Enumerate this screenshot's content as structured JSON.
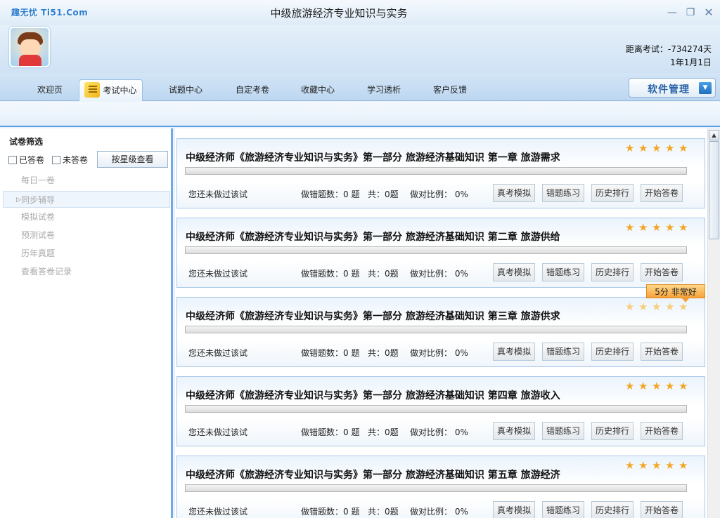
{
  "app": {
    "logo": "趣无忧 Ti51.Com",
    "title": "中级旅游经济专业知识与实务"
  },
  "window_controls": {
    "minimize": "—",
    "maximize": "❐",
    "close": "✕"
  },
  "header": {
    "countdown": "距离考试：-734274天",
    "exam_date": "1年1月1日"
  },
  "nav": {
    "tabs": [
      "欢迎页",
      "考试中心",
      "试题中心",
      "自定考卷",
      "收藏中心",
      "学习透析",
      "客户反馈"
    ],
    "active_index": 1,
    "software_mgmt": "软件管理",
    "dropdown_glyph": "▼"
  },
  "sidebar": {
    "filter_title": "试卷筛选",
    "answered": "已答卷",
    "unanswered": "未答卷",
    "star_view": "按星级查看",
    "items": [
      "每日一卷",
      "同步辅导",
      "模拟试卷",
      "预测试卷",
      "历年真题",
      "查看答卷记录"
    ],
    "selected_index": 1
  },
  "cards": [
    {
      "title": "中级经济师《旅游经济专业知识与实务》第一部分  旅游经济基础知识  第一章  旅游需求",
      "rating": 5,
      "progress": 0,
      "status": "您还未做过该试",
      "wrong": "做错题数：0 题",
      "total": "共：0题",
      "ratio": "做对比例： 0%"
    },
    {
      "title": "中级经济师《旅游经济专业知识与实务》第一部分  旅游经济基础知识  第二章  旅游供给",
      "rating": 5,
      "progress": 0,
      "status": "您还未做过该试",
      "wrong": "做错题数：0 题",
      "total": "共：0题",
      "ratio": "做对比例： 0%"
    },
    {
      "title": "中级经济师《旅游经济专业知识与实务》第一部分  旅游经济基础知识  第三章  旅游供求",
      "rating": 5,
      "progress": 0,
      "status": "您还未做过该试",
      "wrong": "做错题数：0 题",
      "total": "共：0题",
      "ratio": "做对比例： 0%"
    },
    {
      "title": "中级经济师《旅游经济专业知识与实务》第一部分  旅游经济基础知识  第四章  旅游收入",
      "rating": 5,
      "progress": 0,
      "status": "您还未做过该试",
      "wrong": "做错题数：0 题",
      "total": "共：0题",
      "ratio": "做对比例： 0%"
    },
    {
      "title": "中级经济师《旅游经济专业知识与实务》第一部分  旅游经济基础知识  第五章  旅游经济",
      "rating": 5,
      "progress": 0,
      "status": "您还未做过该试",
      "wrong": "做错题数：0 题",
      "total": "共：0题",
      "ratio": "做对比例： 0%"
    }
  ],
  "card_buttons": {
    "mock": "真考模拟",
    "wrong": "错题练习",
    "rank": "历史排行",
    "start": "开始答卷"
  },
  "tooltip": "5分  非常好",
  "scroll": {
    "up": "▲"
  },
  "colors": {
    "accent": "#2460a7",
    "star": "#f2a623",
    "border": "#a9c9e8"
  },
  "icons": {
    "star": "★"
  }
}
